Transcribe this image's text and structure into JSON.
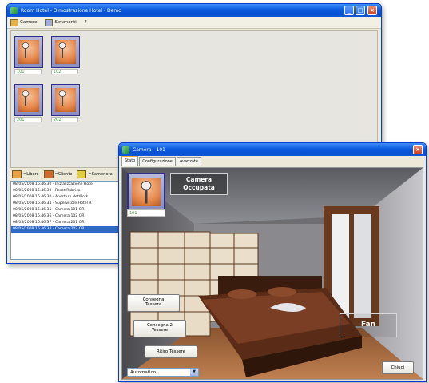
{
  "main_window": {
    "title": "Room Hotel - Dimostrazione Hotel - Demo",
    "toolbar": {
      "item1": "Camere",
      "item2": "Strumenti",
      "item3": "?"
    },
    "rooms": [
      {
        "label": "101"
      },
      {
        "label": "102"
      },
      {
        "label": "201"
      },
      {
        "label": "202"
      }
    ],
    "legend": [
      {
        "text": "=Libero",
        "color": "#e8a040"
      },
      {
        "text": "=Cliente",
        "color": "#d06a30"
      },
      {
        "text": "=Cameriera",
        "color": "#e0d040"
      }
    ],
    "log": [
      "08/05/2008 16.46.30 - Inizializzazione Hotel",
      "08/05/2008 16.46.30 - Reset Rubrica",
      "08/05/2008 16.46.30 - Apertura NetWork",
      "08/05/2008 16.46.34 - Supervisore Hotel R",
      "08/05/2008 16.46.35 - Camera 101 OR",
      "08/05/2008 16.46.36 - Camera 102 OR",
      "08/05/2008 16.46.37 - Camera 201 OR",
      "08/05/2008 16.46.38 - Camera 202 OR"
    ]
  },
  "camera_dialog": {
    "title": "Camera - 101",
    "tabs": [
      "Stato",
      "Configurazione",
      "Avanzate"
    ],
    "room_label": "101",
    "status_line1": "Camera",
    "status_line2": "Occupata",
    "btn_consegna_line1": "Consegna",
    "btn_consegna_line2": "Tessera",
    "btn_consegna2_line1": "Consegna 2",
    "btn_consegna2_line2": "Tessere",
    "btn_ritiro": "Ritiro Tessere",
    "fan_label": "Fan",
    "mode_select": "Automatico",
    "close_button": "Chiudi"
  }
}
